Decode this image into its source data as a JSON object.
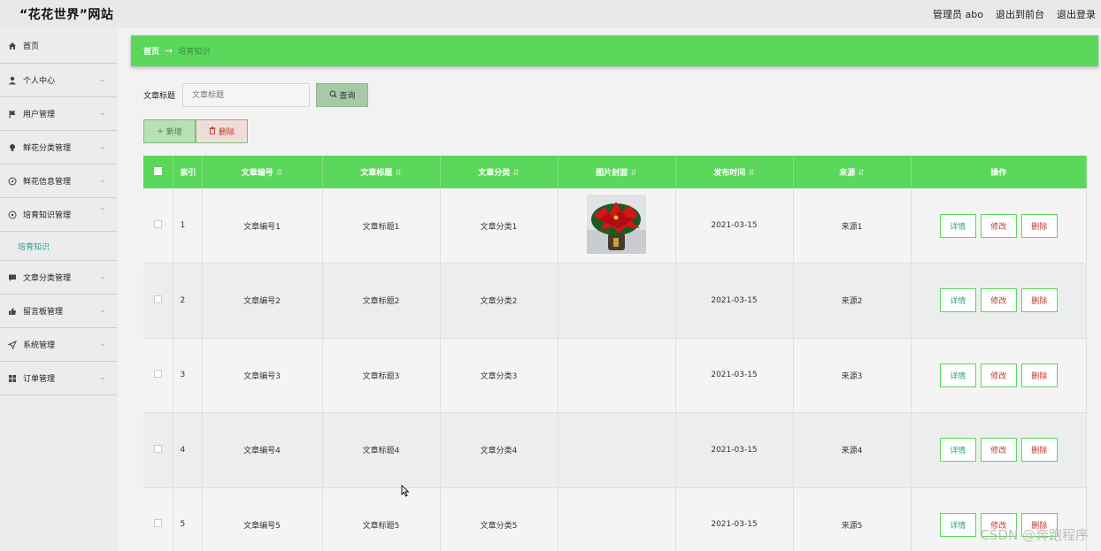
{
  "header": {
    "title": "“花花世界”网站",
    "user": "管理员 abo",
    "front_link": "退出到前台",
    "logout": "退出登录"
  },
  "sidebar": {
    "items": [
      {
        "label": "首页",
        "icon": "home-icon"
      },
      {
        "label": "个人中心",
        "icon": "user-icon"
      },
      {
        "label": "用户管理",
        "icon": "flag-icon"
      },
      {
        "label": "鲜花分类管理",
        "icon": "bulb-icon"
      },
      {
        "label": "鲜花信息管理",
        "icon": "compass-icon"
      },
      {
        "label": "培育知识管理",
        "icon": "globe-icon"
      },
      {
        "label": "文章分类管理",
        "icon": "chat-icon"
      },
      {
        "label": "留言板管理",
        "icon": "thumb-icon"
      },
      {
        "label": "系统管理",
        "icon": "send-icon"
      },
      {
        "label": "订单管理",
        "icon": "grid-icon"
      }
    ],
    "submenu": "培育知识"
  },
  "breadcrumb": {
    "home": "首页",
    "current": "培育知识"
  },
  "search": {
    "label": "文章标题",
    "placeholder": "文章标题",
    "button": "查询"
  },
  "actions": {
    "add": "新增",
    "delete": "删除"
  },
  "table": {
    "headers": [
      "索引",
      "文章编号",
      "文章标题",
      "文章分类",
      "图片封面",
      "发布时间",
      "来源",
      "操作"
    ],
    "rows": [
      {
        "index": "1",
        "code": "文章编号1",
        "title": "文章标题1",
        "category": "文章分类1",
        "date": "2021-03-15",
        "source": "来源1",
        "has_image": true
      },
      {
        "index": "2",
        "code": "文章编号2",
        "title": "文章标题2",
        "category": "文章分类2",
        "date": "2021-03-15",
        "source": "来源2",
        "has_image": false
      },
      {
        "index": "3",
        "code": "文章编号3",
        "title": "文章标题3",
        "category": "文章分类3",
        "date": "2021-03-15",
        "source": "来源3",
        "has_image": false
      },
      {
        "index": "4",
        "code": "文章编号4",
        "title": "文章标题4",
        "category": "文章分类4",
        "date": "2021-03-15",
        "source": "来源4",
        "has_image": false
      },
      {
        "index": "5",
        "code": "文章编号5",
        "title": "文章标题5",
        "category": "文章分类5",
        "date": "2021-03-15",
        "source": "来源5",
        "has_image": false
      }
    ],
    "row_actions": {
      "detail": "详情",
      "edit": "修改",
      "remove": "删除"
    }
  },
  "watermark": "CSDN @奔跑程序",
  "colors": {
    "accent": "#5bd75b",
    "link": "#2a9d8f",
    "danger": "#c0392b"
  }
}
